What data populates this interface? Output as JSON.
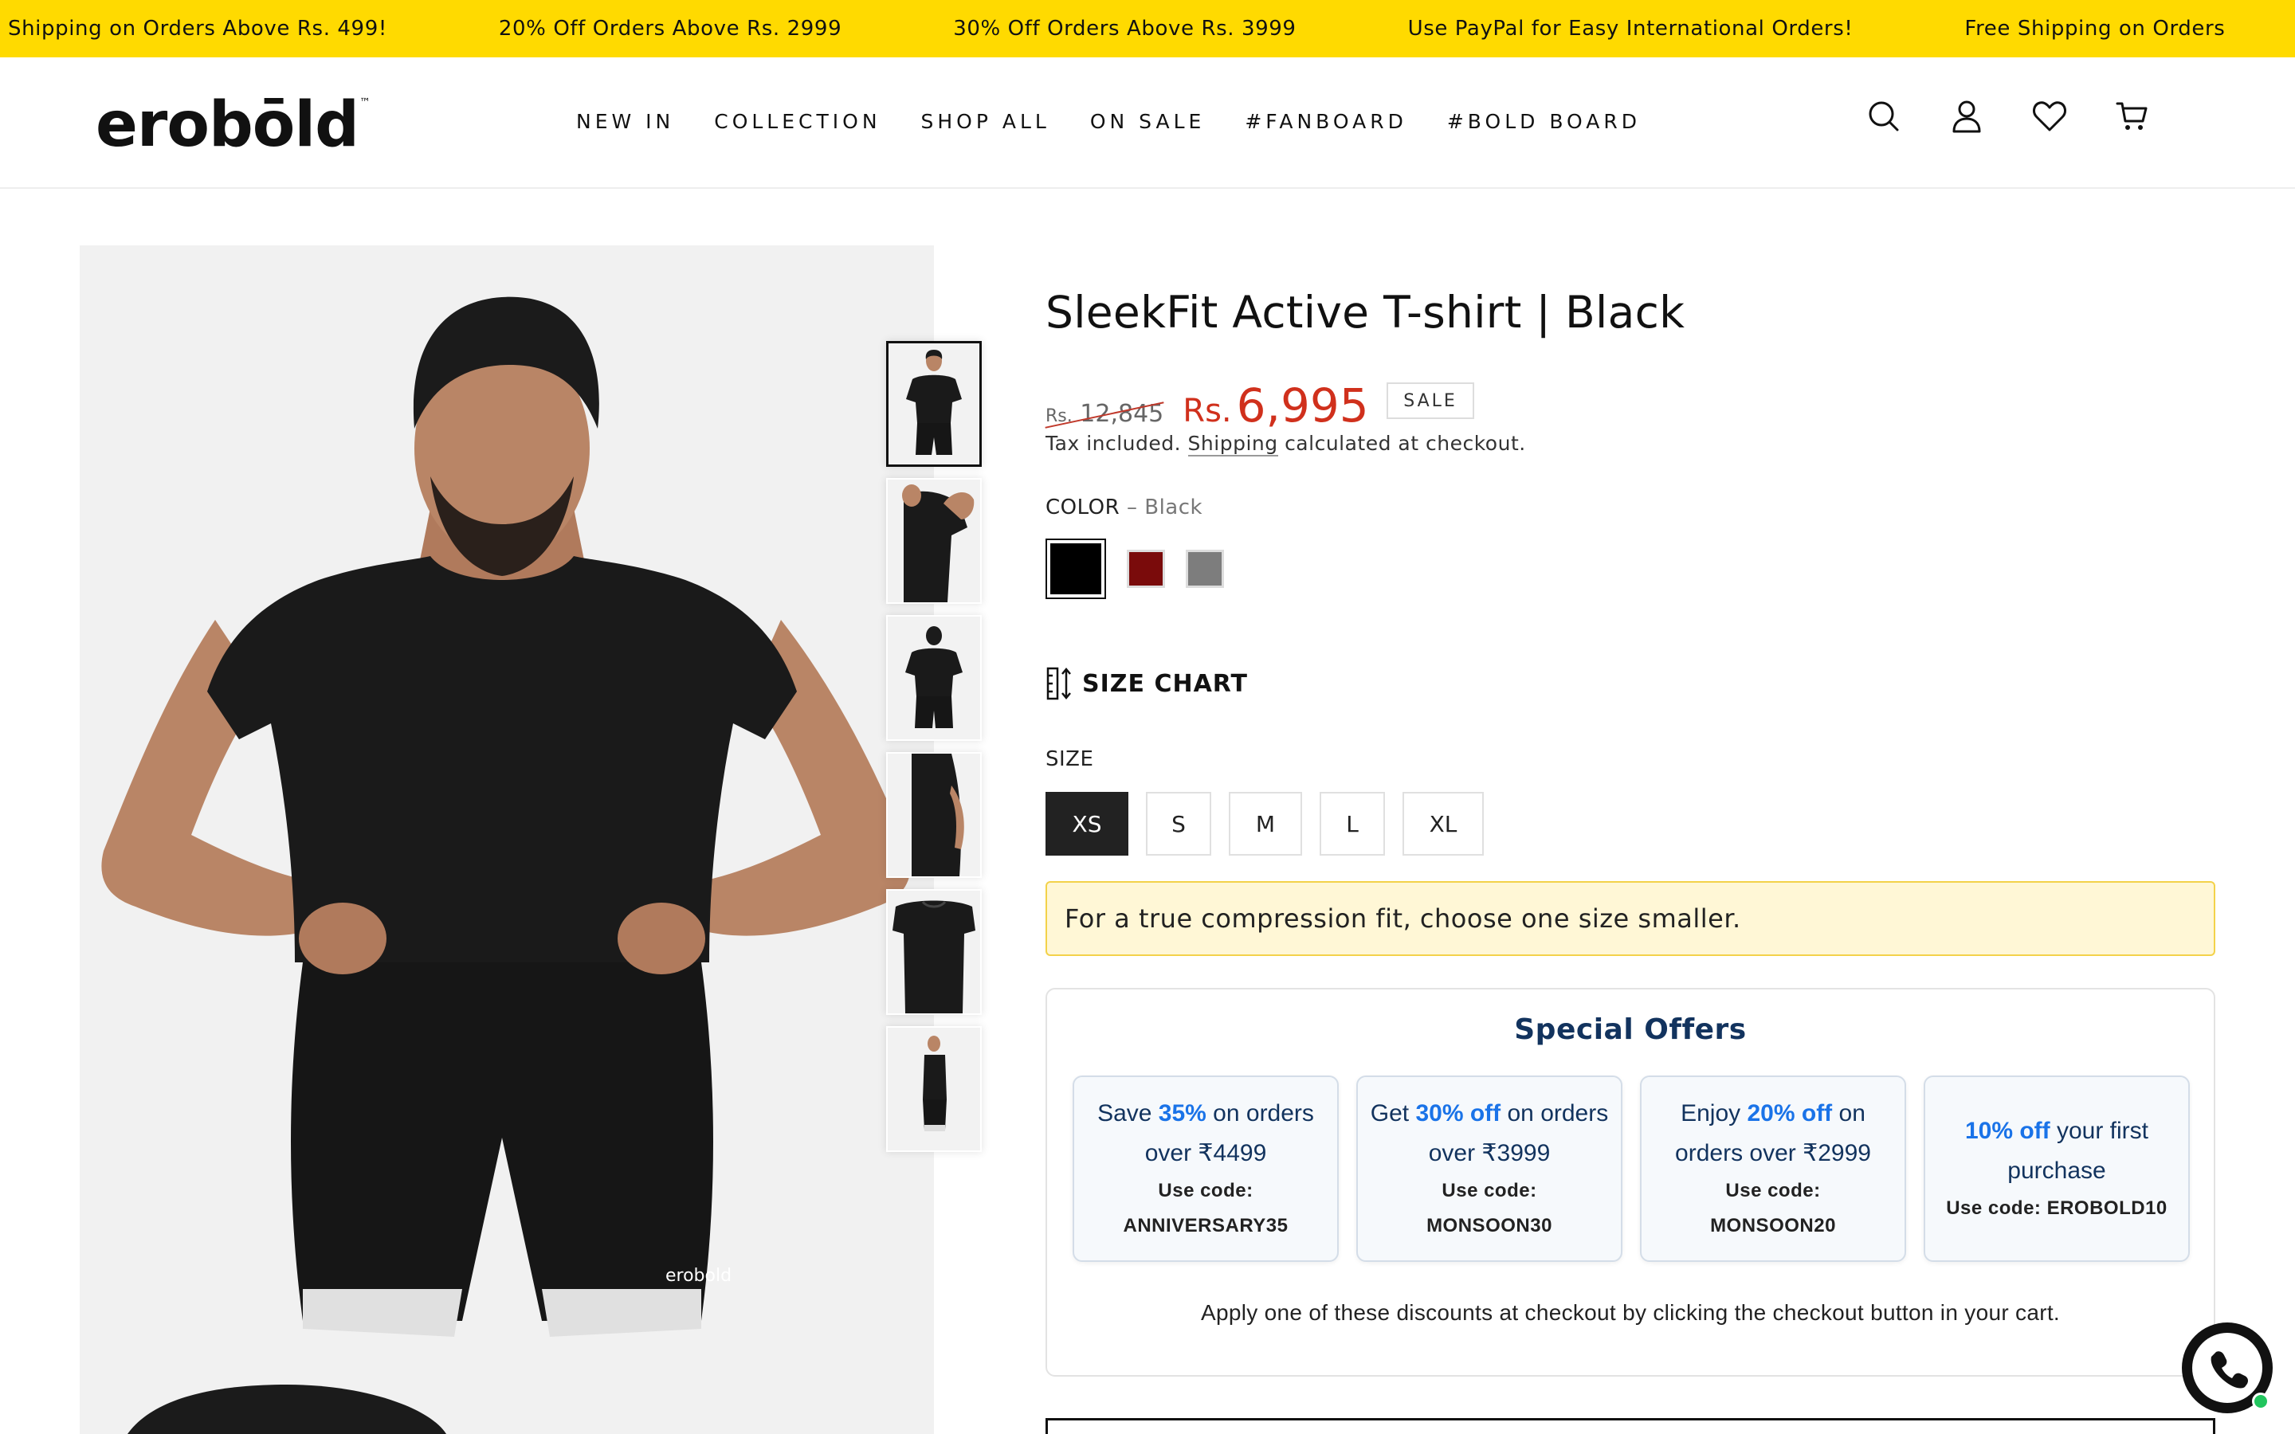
{
  "announcement": {
    "items": [
      "Shipping on Orders Above Rs. 499!",
      "20% Off Orders Above Rs. 2999",
      "30% Off Orders Above Rs. 3999",
      "Use PayPal for Easy International Orders!",
      "Free Shipping on Orders"
    ]
  },
  "header": {
    "logo": "erobōld",
    "logo_tm": "™",
    "nav": [
      "NEW IN",
      "COLLECTION",
      "SHOP ALL",
      "ON SALE",
      "#FANBOARD",
      "#BOLD BOARD"
    ],
    "icons": [
      "search-icon",
      "account-icon",
      "wishlist-icon",
      "cart-icon"
    ]
  },
  "gallery": {
    "thumbnail_count": 6,
    "active_index": 0,
    "logo_on_shorts": "erobold"
  },
  "product": {
    "title": "SleekFit Active T-shirt | Black",
    "old_price_currency": "Rs.",
    "old_price": "12,845",
    "price_currency": "Rs.",
    "price": "6,995",
    "badge": "SALE",
    "tax_prefix": "Tax included.",
    "tax_link": "Shipping",
    "tax_suffix": "calculated at checkout.",
    "color_label": "COLOR",
    "color_sep": "–",
    "color_value": "Black",
    "swatches": [
      "#000000",
      "#7a0b0b",
      "#7d7d7d"
    ],
    "size_chart_label": "SIZE CHART",
    "size_label": "SIZE",
    "sizes": [
      "XS",
      "S",
      "M",
      "L",
      "XL"
    ],
    "selected_size": "XS",
    "fit_note": "For a true compression fit, choose one size smaller."
  },
  "offers": {
    "title": "Special Offers",
    "cards": [
      {
        "pre": "Save ",
        "hl": "35%",
        "post": " on orders over ₹4499",
        "code_label": "Use code:",
        "code": "ANNIVERSARY35"
      },
      {
        "pre": "Get ",
        "hl": "30% off",
        "post": " on orders over ₹3999",
        "code_label": "Use code:",
        "code": "MONSOON30"
      },
      {
        "pre": "Enjoy ",
        "hl": "20% off",
        "post": " on orders over ₹2999",
        "code_label": "Use code:",
        "code": "MONSOON20"
      },
      {
        "pre": "",
        "hl": "10% off",
        "post": " your first purchase",
        "code_label": "Use code:",
        "code": "EROBOLD10"
      }
    ],
    "footer": "Apply one of these discounts at checkout by clicking the checkout button in your cart."
  },
  "colors": {
    "announce_bg": "#ffda00",
    "sale_red": "#d0301c",
    "offer_navy": "#12335e",
    "offer_blue": "#1a73e8",
    "note_bg": "#fff7d6"
  }
}
